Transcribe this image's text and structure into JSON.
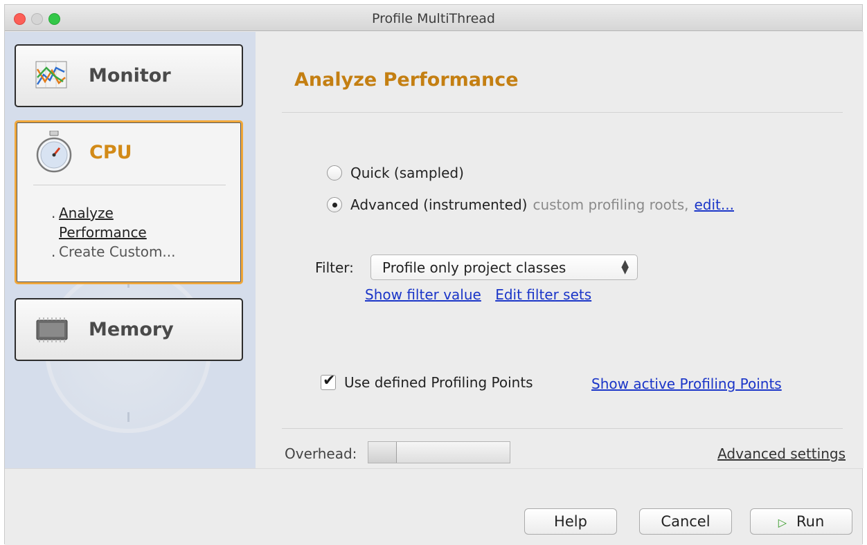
{
  "window": {
    "title": "Profile MultiThread"
  },
  "sidebar": {
    "categories": [
      {
        "label": "Monitor",
        "icon": "monitor-chart-icon"
      },
      {
        "label": "CPU",
        "icon": "stopwatch-icon",
        "items": [
          {
            "prefix": ".",
            "label": "Analyze Performance"
          },
          {
            "prefix": ".",
            "label": "Create Custom..."
          }
        ]
      },
      {
        "label": "Memory",
        "icon": "memory-chip-icon"
      }
    ]
  },
  "main": {
    "heading": "Analyze Performance",
    "modes": [
      {
        "label": "Quick (sampled)",
        "selected": false
      },
      {
        "label": "Advanced (instrumented)",
        "selected": true,
        "note": "custom profiling roots,",
        "link": "edit..."
      }
    ],
    "filter": {
      "label": "Filter:",
      "selected": "Profile only project classes",
      "links": [
        "Show filter value",
        "Edit filter sets"
      ]
    },
    "profiling_points": {
      "label": "Use defined Profiling Points",
      "checked": true,
      "link": "Show active Profiling Points"
    },
    "overhead": {
      "label": "Overhead:",
      "level": 0.2
    },
    "advanced_settings": "Advanced settings"
  },
  "footer": {
    "help": "Help",
    "cancel": "Cancel",
    "run": "Run"
  },
  "colors": {
    "accent": "#d28a18",
    "link": "#1a35c8",
    "selected_border": "#f0a73a",
    "sidebar_bg": "#d5ddeb"
  }
}
